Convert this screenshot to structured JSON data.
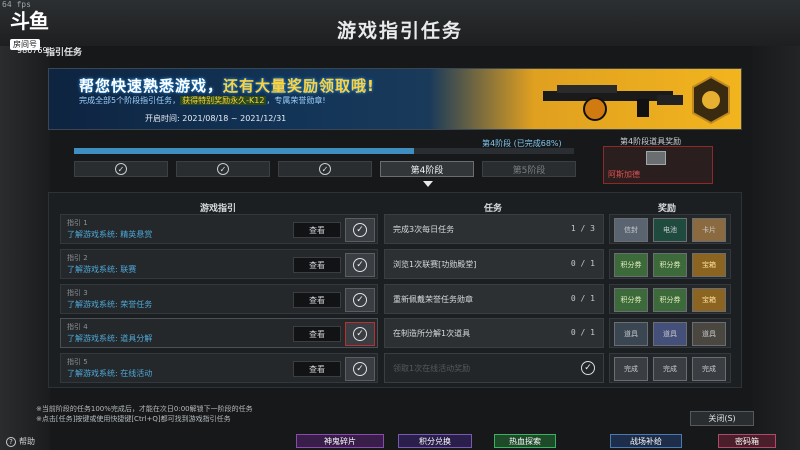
{
  "fps": "64 fps",
  "streamer": {
    "logo": "斗鱼",
    "room_label": "房间号",
    "room_number": "986769"
  },
  "title": "游戏指引任务",
  "header_label": "指引任务",
  "banner": {
    "headline_a": "帮您快速熟悉游戏，",
    "headline_b": "还有大量奖励领取哦!",
    "sub_a": "完成全部5个阶段指引任务，",
    "sub_hl": "获得特别奖励永久-K12",
    "sub_b": "，专属荣誉勋章!",
    "date": "开启时间: 2021/08/18 ~ 2021/12/31"
  },
  "progress": {
    "label": "第4阶段 (已完成68%)",
    "percent": 68
  },
  "stages": [
    {
      "label": "第1阶段",
      "done": true
    },
    {
      "label": "第2阶段",
      "done": true
    },
    {
      "label": "第3阶段",
      "done": true
    },
    {
      "label": "第4阶段",
      "active": true
    },
    {
      "label": "第5阶段"
    }
  ],
  "reward_preview": {
    "label": "第4阶段道具奖励",
    "caption": "阿斯加德"
  },
  "columns": {
    "guide": "游戏指引",
    "task": "任务",
    "reward": "奖励"
  },
  "view_label": "查看",
  "guides": [
    {
      "num": "指引 1",
      "text": "了解游戏系统: 精英悬赏"
    },
    {
      "num": "指引 2",
      "text": "了解游戏系统: 联赛"
    },
    {
      "num": "指引 3",
      "text": "了解游戏系统: 荣誉任务"
    },
    {
      "num": "指引 4",
      "text": "了解游戏系统: 道具分解"
    },
    {
      "num": "指引 5",
      "text": "了解游戏系统: 在线活动"
    }
  ],
  "tasks": [
    {
      "text": "完成3次每日任务",
      "count": "1 / 3"
    },
    {
      "text": "浏览1次联赛[功勋殿堂]",
      "count": "0 / 1"
    },
    {
      "text": "重新佩戴荣誉任务勋章",
      "count": "0 / 1"
    },
    {
      "text": "在制造所分解1次道具",
      "count": "0 / 1"
    },
    {
      "text": "领取1次在线活动奖励",
      "count": "",
      "completed": true
    }
  ],
  "rewards": [
    [
      "信封",
      "电池",
      "卡片"
    ],
    [
      "积分券",
      "积分券",
      "宝箱"
    ],
    [
      "积分券",
      "积分券",
      "宝箱"
    ],
    [
      "道具",
      "道具",
      "道具"
    ],
    [
      "完成",
      "完成",
      "完成"
    ]
  ],
  "notes": [
    "※当前阶段的任务100%完成后，才能在次日0:00解锁下一阶段的任务",
    "※点击[任务]按键或使用快捷键[Ctrl+Q]都可找到游戏指引任务"
  ],
  "close_label": "关闭(S)",
  "help_label": "帮助",
  "bottom_buttons": [
    "神鬼碎片",
    "积分兑换",
    "热血探索",
    "战场补给",
    "密码箱"
  ],
  "colors": {
    "accent_blue": "#3e8fc0",
    "link_blue": "#4fa8d8",
    "gold": "#f2b51e",
    "red_border": "#b83030"
  }
}
